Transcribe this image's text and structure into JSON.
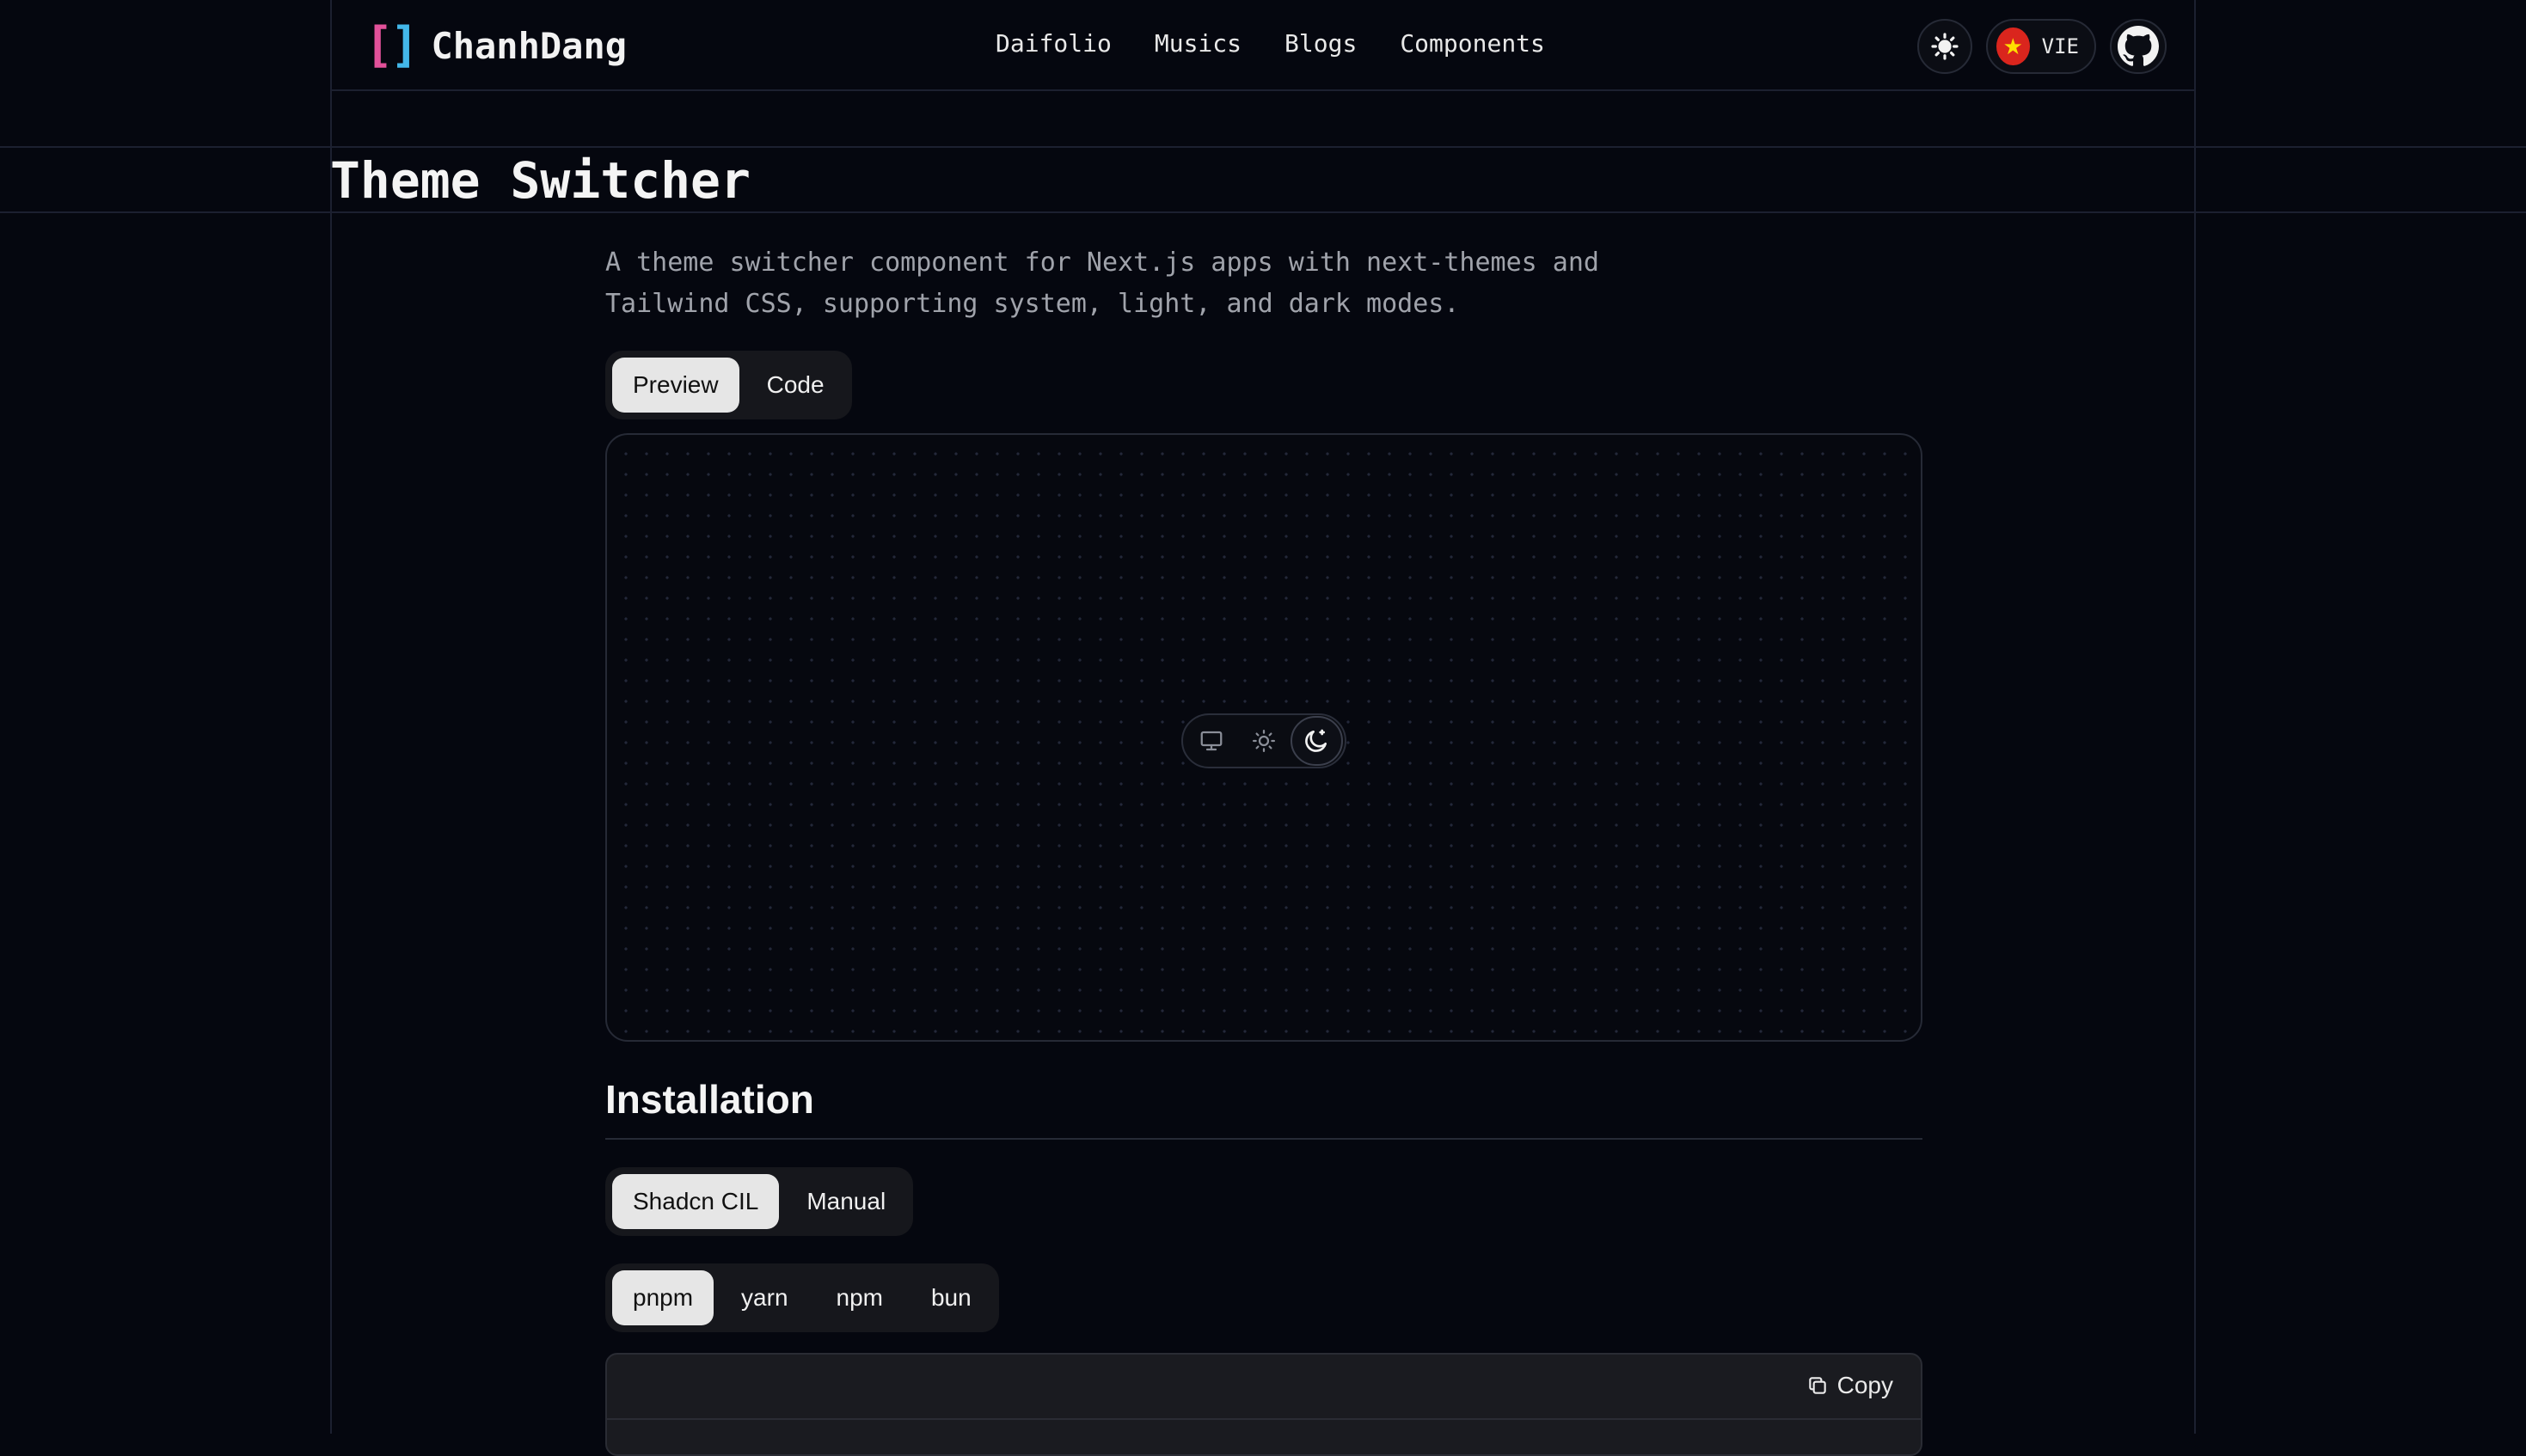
{
  "header": {
    "brand": "ChanhDang",
    "nav": [
      "Daifolio",
      "Musics",
      "Blogs",
      "Components"
    ],
    "theme_icon": "sun-icon",
    "language": "VIE",
    "flag_icon": "vietnam-flag-icon",
    "github_icon": "github-icon"
  },
  "page": {
    "title": "Theme Switcher",
    "description": "A theme switcher component for Next.js apps with next-themes and Tailwind CSS, supporting system, light, and dark modes."
  },
  "view_tabs": {
    "items": [
      "Preview",
      "Code"
    ],
    "active": "Preview"
  },
  "preview": {
    "switcher": {
      "options": [
        "system",
        "light",
        "dark"
      ],
      "option_icons": [
        "monitor-icon",
        "sun-icon",
        "moon-icon"
      ],
      "selected": "dark"
    }
  },
  "installation": {
    "heading": "Installation",
    "method_tabs": [
      "Shadcn CIL",
      "Manual"
    ],
    "method_active": "Shadcn CIL",
    "pm_tabs": [
      "pnpm",
      "yarn",
      "npm",
      "bun"
    ],
    "pm_active": "pnpm",
    "copy_label": "Copy"
  },
  "colors": {
    "background": "#05070f",
    "brand_left": "#e2519a",
    "brand_right": "#43b7e9",
    "active_tab": "#e6e6e6"
  }
}
